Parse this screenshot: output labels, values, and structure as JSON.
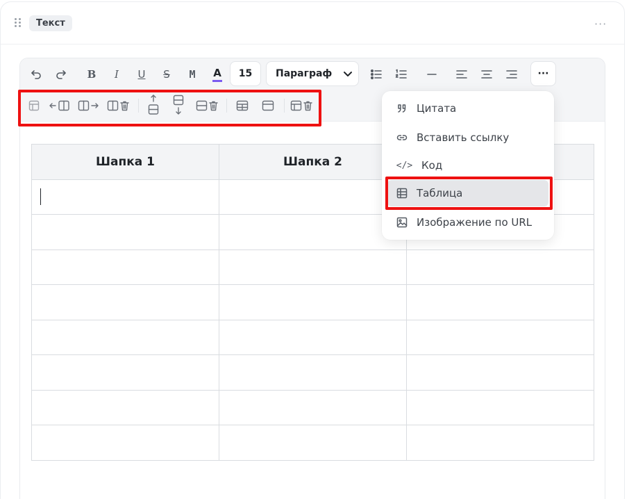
{
  "block": {
    "tag": "Текст",
    "more": "···"
  },
  "toolbar": {
    "bold": "B",
    "italic": "I",
    "underline": "U",
    "strike": "S",
    "mono": "M",
    "color_letter": "A",
    "font_size": "15",
    "paragraph": "Параграф",
    "more": "···"
  },
  "table_toolbar": {
    "icons": [
      "table-properties-icon",
      "add-column-left-icon",
      "add-column-right-icon",
      "delete-column-icon",
      "add-row-above-icon",
      "add-row-below-icon",
      "delete-row-icon",
      "merge-cells-icon",
      "toggle-header-icon",
      "delete-table-icon"
    ]
  },
  "table": {
    "headers": [
      "Шапка 1",
      "Шапка 2",
      ""
    ]
  },
  "insert_menu": {
    "items": [
      {
        "label": "Цитата",
        "icon": "quote-icon"
      },
      {
        "label": "Вставить ссылку",
        "icon": "link-icon"
      },
      {
        "label": "Код",
        "icon": "code-icon",
        "glyph": "</>"
      },
      {
        "label": "Таблица",
        "icon": "table-icon"
      },
      {
        "label": "Изображение по URL",
        "icon": "image-icon"
      }
    ]
  },
  "colors": {
    "highlight": "#ee1111",
    "accent_underline": "#7b5cf0"
  }
}
